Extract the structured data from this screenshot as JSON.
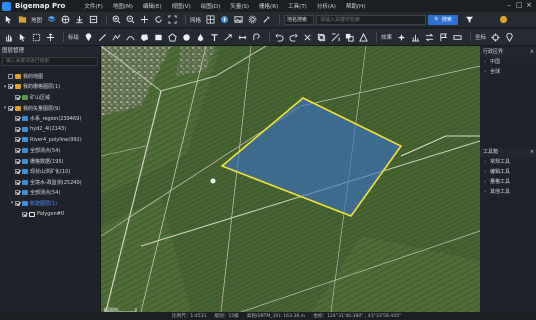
{
  "app": {
    "title": "Bigemap Pro"
  },
  "menu": [
    "文件(F)",
    "地图(M)",
    "编辑(E)",
    "视图(V)",
    "绘图(D)",
    "矢量(S)",
    "栅格(R)",
    "工具(T)",
    "分析(A)",
    "帮助(H)"
  ],
  "toolbar1": {
    "map_label": "地图",
    "grid_label": "网格",
    "search_mode": "地名搜索",
    "search_placeholder": "请输入关键字检索",
    "search_button": "搜索"
  },
  "toolbar2": {
    "measure_label": "标绘",
    "effects_label": "效果",
    "coords_label": "坐标"
  },
  "left_panel": {
    "header": "图层管理",
    "search_placeholder": "输入关键词进行搜索",
    "tree": [
      {
        "label": "我的地图",
        "level": 0,
        "checked": false,
        "icon": "folder",
        "color": "#e0a030",
        "caret": ""
      },
      {
        "label": "我的栅格图层(1)",
        "level": 0,
        "checked": true,
        "icon": "folder",
        "color": "#e0a030",
        "caret": "▾"
      },
      {
        "label": "矿山区域",
        "level": 1,
        "checked": true,
        "icon": "raster",
        "color": "#5a9a4a",
        "caret": ""
      },
      {
        "label": "我的矢量图层(9)",
        "level": 0,
        "checked": true,
        "icon": "folder",
        "color": "#e0a030",
        "caret": "▾"
      },
      {
        "label": "水系_region(239469)",
        "level": 1,
        "checked": true,
        "icon": "vector",
        "color": "#3c8fd8",
        "caret": ""
      },
      {
        "label": "hyd2_4l(2143)",
        "level": 1,
        "checked": true,
        "icon": "vector",
        "color": "#3c8fd8",
        "caret": ""
      },
      {
        "label": "River4_polyline(992)",
        "level": 1,
        "checked": true,
        "icon": "vector",
        "color": "#3c8fd8",
        "caret": ""
      },
      {
        "label": "全部测点(54)",
        "level": 1,
        "checked": true,
        "icon": "vector",
        "color": "#3c8fd8",
        "caret": ""
      },
      {
        "label": "栅格数据(195)",
        "level": 1,
        "checked": true,
        "icon": "vector",
        "color": "#3c8fd8",
        "caret": ""
      },
      {
        "label": "现状山洪矿化(10)",
        "level": 1,
        "checked": true,
        "icon": "vector",
        "color": "#3c8fd8",
        "caret": ""
      },
      {
        "label": "全境水-政监测(25240)",
        "level": 1,
        "checked": true,
        "icon": "vector",
        "color": "#3c8fd8",
        "caret": ""
      },
      {
        "label": "全部测点(54)",
        "level": 1,
        "checked": true,
        "icon": "vector",
        "color": "#3c8fd8",
        "caret": ""
      },
      {
        "label": "新建图层(1)",
        "level": 1,
        "checked": true,
        "icon": "vector",
        "color": "#3c8fd8",
        "caret": "▾",
        "selected": true
      },
      {
        "label": "Polygon#0",
        "level": 2,
        "checked": true,
        "icon": "polygon",
        "color": "#e8e8e8",
        "caret": ""
      }
    ]
  },
  "right_panel": {
    "layers_header": "行政区界",
    "layers_items": [
      "中国",
      "全球"
    ],
    "tools_header": "工具箱",
    "tools_items": [
      "常规工具",
      "编辑工具",
      "量格工具",
      "其他工具"
    ]
  },
  "map": {
    "scale_top": "200m",
    "scale_bottom": "1000ft"
  },
  "status": {
    "scale": "比例尺：1:4531",
    "level": "级别：15级",
    "elevation": "高程(SRTM_30): 163.38 m",
    "coords": "坐标：124°31'40.380\" , 43°33'58.445\""
  },
  "colors": {
    "accent": "#2e6fd8",
    "polygon_fill": "#3a73c8",
    "polygon_stroke": "#f2e233",
    "selected_text": "#4a93ff"
  }
}
